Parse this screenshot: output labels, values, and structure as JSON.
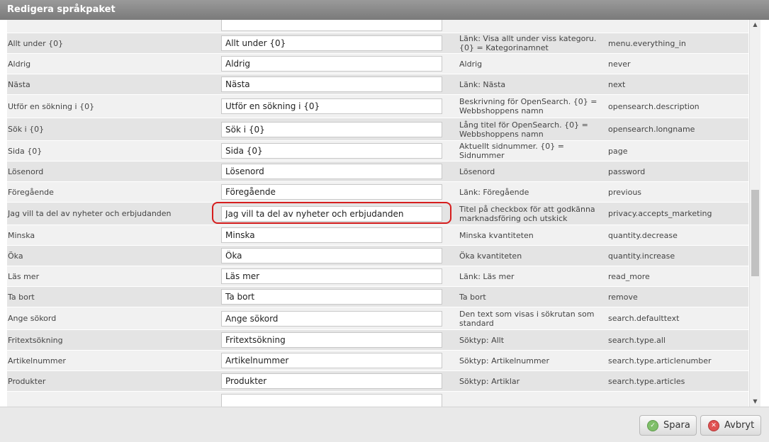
{
  "window": {
    "title": "Redigera språkpaket"
  },
  "rows": [
    {
      "name": "",
      "value": "",
      "description": "",
      "key": ""
    },
    {
      "name": "Allt under {0}",
      "value": "Allt under {0}",
      "description": "Länk: Visa allt under viss kategoru. {0} = Kategorinamnet",
      "key": "menu.everything_in"
    },
    {
      "name": "Aldrig",
      "value": "Aldrig",
      "description": "Aldrig",
      "key": "never"
    },
    {
      "name": "Nästa",
      "value": "Nästa",
      "description": "Länk: Nästa",
      "key": "next"
    },
    {
      "name": "Utför en sökning i {0}",
      "value": "Utför en sökning i {0}",
      "description": "Beskrivning för OpenSearch. {0} = Webbshoppens namn",
      "key": "opensearch.description"
    },
    {
      "name": "Sök i {0}",
      "value": "Sök i {0}",
      "description": "Lång titel för OpenSearch. {0} = Webbshoppens namn",
      "key": "opensearch.longname"
    },
    {
      "name": "Sida {0}",
      "value": "Sida {0}",
      "description": "Aktuellt sidnummer. {0} = Sidnummer",
      "key": "page"
    },
    {
      "name": "Lösenord",
      "value": "Lösenord",
      "description": "Lösenord",
      "key": "password"
    },
    {
      "name": "Föregående",
      "value": "Föregående",
      "description": "Länk: Föregående",
      "key": "previous"
    },
    {
      "name": "Jag vill ta del av nyheter och erbjudanden",
      "value": "Jag vill ta del av nyheter och erbjudanden",
      "description": "Titel på checkbox för att godkänna marknadsföring och utskick",
      "key": "privacy.accepts_marketing"
    },
    {
      "name": "Minska",
      "value": "Minska",
      "description": "Minska kvantiteten",
      "key": "quantity.decrease"
    },
    {
      "name": "Öka",
      "value": "Öka",
      "description": "Öka kvantiteten",
      "key": "quantity.increase"
    },
    {
      "name": "Läs mer",
      "value": "Läs mer",
      "description": "Länk: Läs mer",
      "key": "read_more"
    },
    {
      "name": "Ta bort",
      "value": "Ta bort",
      "description": "Ta bort",
      "key": "remove"
    },
    {
      "name": "Ange sökord",
      "value": "Ange sökord",
      "description": "Den text som visas i sökrutan som standard",
      "key": "search.defaulttext"
    },
    {
      "name": "Fritextsökning",
      "value": "Fritextsökning",
      "description": "Söktyp: Allt",
      "key": "search.type.all"
    },
    {
      "name": "Artikelnummer",
      "value": "Artikelnummer",
      "description": "Söktyp: Artikelnummer",
      "key": "search.type.articlenumber"
    },
    {
      "name": "Produkter",
      "value": "Produkter",
      "description": "Söktyp: Artiklar",
      "key": "search.type.articles"
    },
    {
      "name": "",
      "value": "",
      "description": "",
      "key": ""
    }
  ],
  "footer": {
    "save_label": "Spara",
    "cancel_label": "Avbryt"
  },
  "icons": {
    "save": "check-icon",
    "cancel": "close-icon",
    "scroll_up": "arrow-up-icon",
    "scroll_down": "arrow-down-icon"
  },
  "colors": {
    "highlight": "#d61e1e",
    "title_bar": "#888888"
  }
}
